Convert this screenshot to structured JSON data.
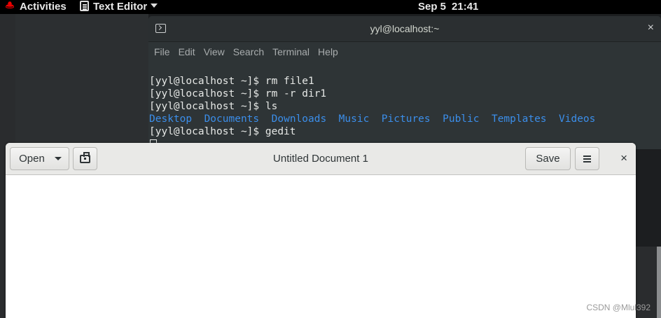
{
  "topbar": {
    "activities": "Activities",
    "app_menu": "Text Editor",
    "date": "Sep 5",
    "time": "21:41"
  },
  "terminal": {
    "title": "yyl@localhost:~",
    "menu": [
      "File",
      "Edit",
      "View",
      "Search",
      "Terminal",
      "Help"
    ],
    "lines": [
      "[yyl@localhost ~]$ rm file1",
      "[yyl@localhost ~]$ rm -r dir1",
      "[yyl@localhost ~]$ ls"
    ],
    "ls_dirs": [
      "Desktop",
      "Documents",
      "Downloads",
      "Music",
      "Pictures",
      "Public",
      "Templates",
      "Videos"
    ],
    "last_line": "[yyl@localhost ~]$ gedit",
    "close_glyph": "×"
  },
  "gedit": {
    "open_label": "Open",
    "title": "Untitled Document 1",
    "save_label": "Save",
    "close_glyph": "×"
  },
  "watermark": "CSDN @Mlul392",
  "colors": {
    "directory": "#3b8eea",
    "terminal_bg": "#2e3436",
    "topbar_bg": "#000000"
  }
}
